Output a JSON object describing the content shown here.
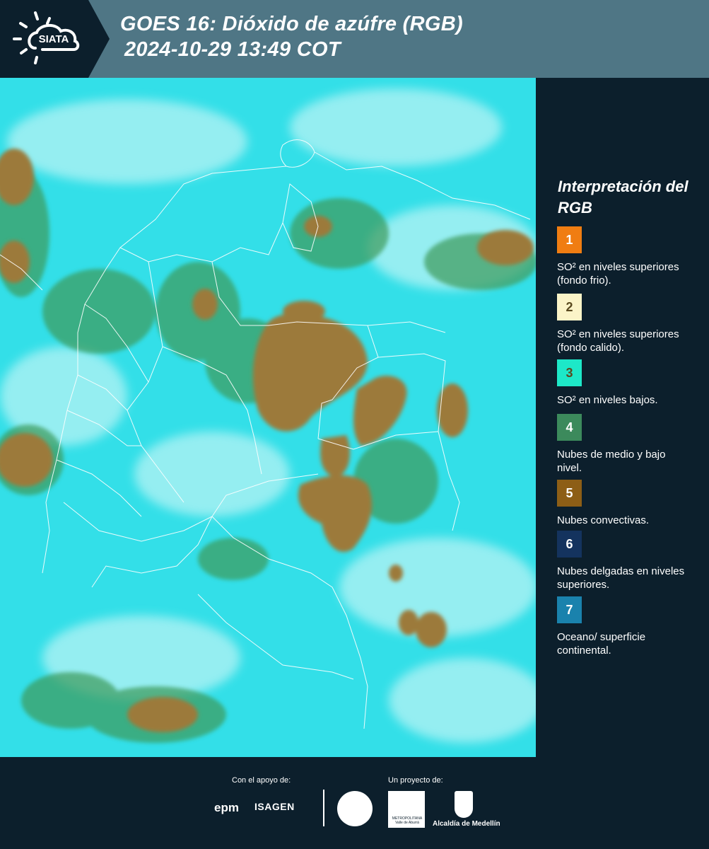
{
  "header": {
    "title_line1": "GOES 16: Dióxido de azúfre (RGB)",
    "title_line2": "2024-10-29 13:49 COT",
    "logo_text": "SIATA",
    "logo_icon": "sun-cloud-icon"
  },
  "map": {
    "description_icon": "satellite-rgb-image",
    "colors": {
      "surface": "#2fe0e6",
      "convective": "#9a7a3c",
      "mid_low": "#3a8a5a",
      "boundary": "#ffffff"
    }
  },
  "legend": {
    "title": "Interpretación del RGB",
    "items": [
      {
        "number": "1",
        "label": "SO² en niveles superiores (fondo frio).",
        "color": "#f07d12"
      },
      {
        "number": "2",
        "label": "SO² en niveles superiores (fondo calido).",
        "color": "#fbf4c8"
      },
      {
        "number": "3",
        "label": "SO² en niveles bajos.",
        "color": "#1de8c8"
      },
      {
        "number": "4",
        "label": "Nubes de medio y bajo nivel.",
        "color": "#3c8a5c"
      },
      {
        "number": "5",
        "label": "Nubes convectivas.",
        "color": "#8d5e16"
      },
      {
        "number": "6",
        "label": "Nubes delgadas en niveles superiores.",
        "color": "#14335e"
      },
      {
        "number": "7",
        "label": "Oceano/ superficie continental.",
        "color": "#1a82ad"
      }
    ]
  },
  "footer": {
    "support_label": "Con el apoyo de:",
    "project_label": "Un proyecto de:",
    "epm": "epm",
    "isagen": "ISAGEN",
    "area_text": "METROPOLITANA Valle de Aburrá",
    "alcaldia": "Alcaldía de Medellín"
  }
}
